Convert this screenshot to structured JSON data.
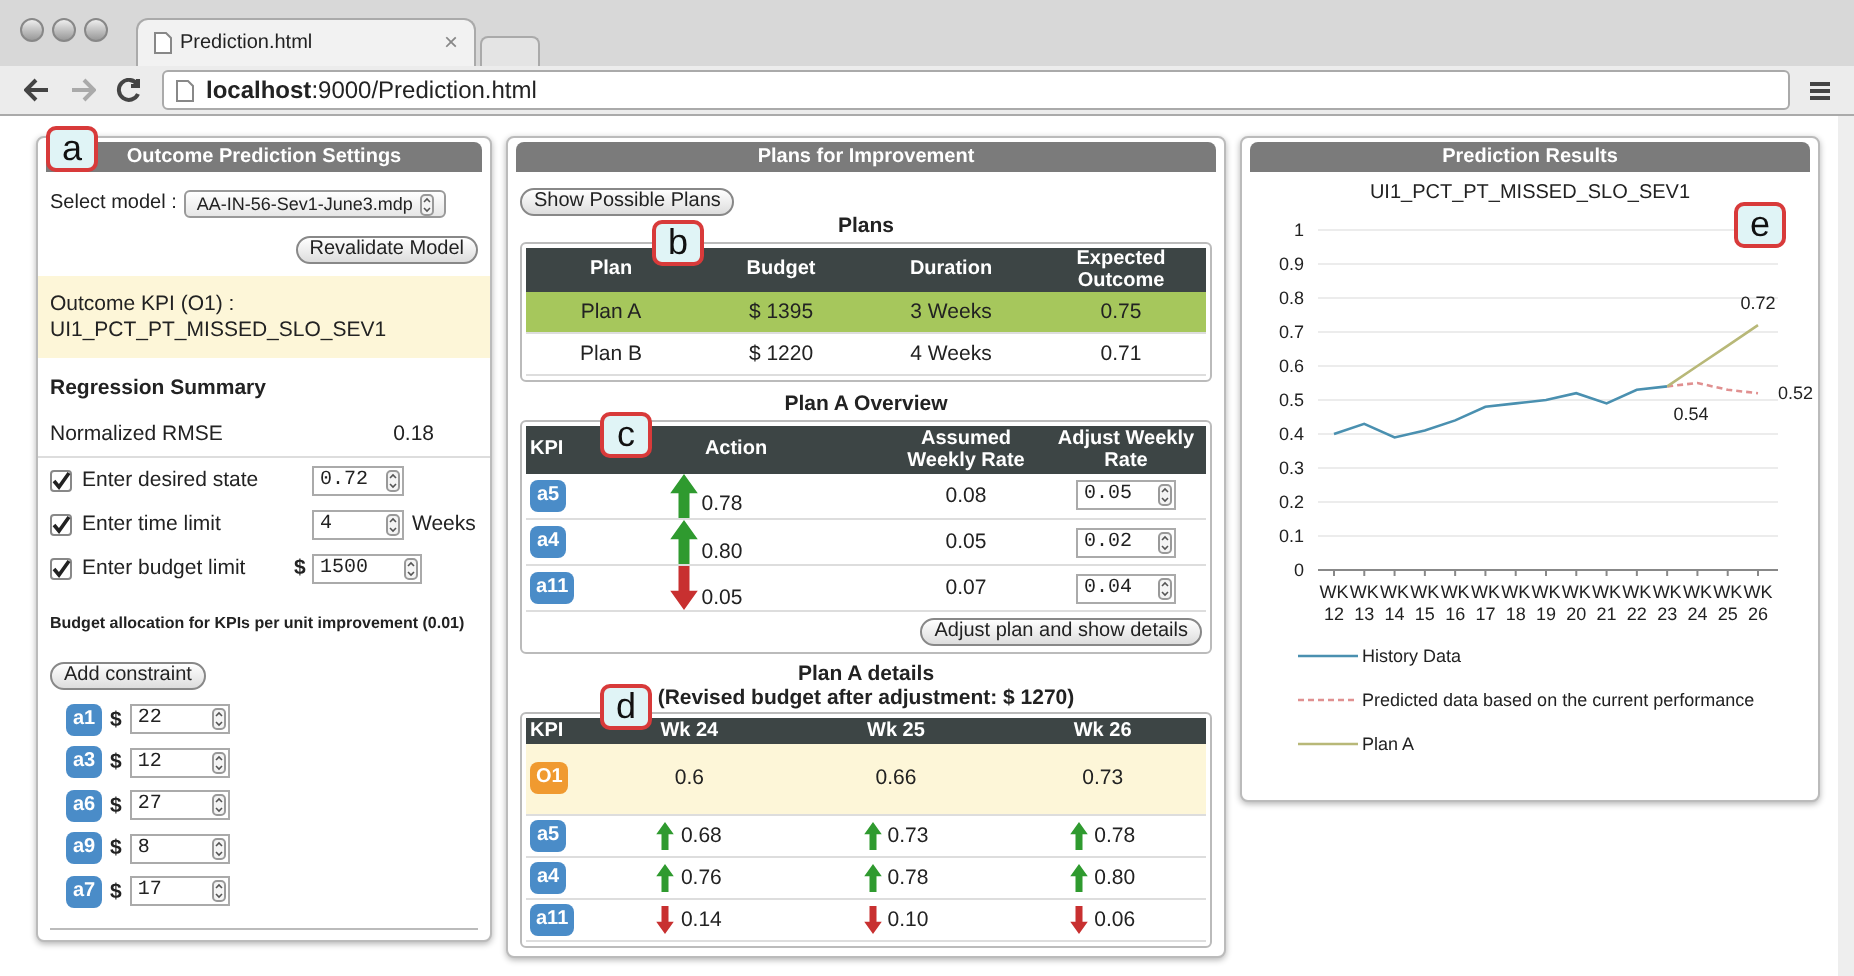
{
  "browser": {
    "tab_title": "Prediction.html",
    "tab_close": "×",
    "url": "**localhost**:9000/Prediction.html"
  },
  "settings": {
    "annotation": "a",
    "title": "Outcome Prediction Settings",
    "model_label": "Select model :",
    "model_value": "AA-IN-56-Sev1-June3.mdp",
    "revalidate_button": "Revalidate Model",
    "outcome_label": "Outcome KPI (O1) :",
    "outcome_value": "UI1_PCT_PT_MISSED_SLO_SEV1",
    "regression_title": "Regression Summary",
    "rmse_label": "Normalized RMSE",
    "rmse_value": "0.18",
    "constraints": [
      {
        "label": "Enter desired state",
        "checked": true,
        "value": "0.72"
      },
      {
        "label": "Enter time limit",
        "checked": true,
        "value": "4",
        "unit": "Weeks"
      },
      {
        "label": "Enter budget limit",
        "checked": true,
        "prefix": "$",
        "value": "1500"
      }
    ],
    "budget_title": "Budget allocation for KPIs per unit improvement (0.01)",
    "add_constraint_button": "Add constraint",
    "allocations": [
      {
        "kpi": "a1",
        "currency": "$",
        "value": "22"
      },
      {
        "kpi": "a3",
        "currency": "$",
        "value": "12"
      },
      {
        "kpi": "a6",
        "currency": "$",
        "value": "27"
      },
      {
        "kpi": "a9",
        "currency": "$",
        "value": "8"
      },
      {
        "kpi": "a7",
        "currency": "$",
        "value": "17"
      }
    ]
  },
  "plans": {
    "title": "Plans for Improvement",
    "show_button": "Show Possible Plans",
    "table_title": "Plans",
    "annotation": "b",
    "columns": [
      "Plan",
      "Budget",
      "Duration",
      "Expected Outcome"
    ],
    "rows": [
      {
        "cells": [
          "Plan A",
          "$ 1395",
          "3 Weeks",
          "0.75"
        ],
        "selected": true
      },
      {
        "cells": [
          "Plan B",
          "$ 1220",
          "4 Weeks",
          "0.71"
        ],
        "selected": false
      }
    ]
  },
  "overview": {
    "title": "Plan A Overview",
    "annotation": "c",
    "columns": [
      "KPI",
      "Action",
      "Assumed Weekly Rate",
      "Adjust Weekly Rate"
    ],
    "rows": [
      {
        "kpi": "a5",
        "kind": "up",
        "action": "0.78",
        "assumed": "0.08",
        "adjust": "0.05"
      },
      {
        "kpi": "a4",
        "kind": "up",
        "action": "0.80",
        "assumed": "0.05",
        "adjust": "0.02"
      },
      {
        "kpi": "a11",
        "kind": "down",
        "action": "0.05",
        "assumed": "0.07",
        "adjust": "0.04"
      }
    ],
    "adjust_button": "Adjust plan and show details"
  },
  "details": {
    "title": "Plan A details",
    "subtitle": "(Revised budget after adjustment: $ 1270)",
    "annotation": "d",
    "kpi_column": "KPI",
    "columns": [
      "Wk 24",
      "Wk 25",
      "Wk 26"
    ],
    "rows": [
      {
        "kpi": "O1",
        "kind": "outcome",
        "cells": [
          {
            "kind": "plain",
            "value": "0.6"
          },
          {
            "kind": "plain",
            "value": "0.66"
          },
          {
            "kind": "plain",
            "value": "0.73"
          }
        ]
      },
      {
        "kpi": "a5",
        "kind": "action",
        "cells": [
          {
            "kind": "up",
            "value": "0.68"
          },
          {
            "kind": "up",
            "value": "0.73"
          },
          {
            "kind": "up",
            "value": "0.78"
          }
        ]
      },
      {
        "kpi": "a4",
        "kind": "action",
        "cells": [
          {
            "kind": "up",
            "value": "0.76"
          },
          {
            "kind": "up",
            "value": "0.78"
          },
          {
            "kind": "up",
            "value": "0.80"
          }
        ]
      },
      {
        "kpi": "a11",
        "kind": "action",
        "cells": [
          {
            "kind": "down",
            "value": "0.14"
          },
          {
            "kind": "down",
            "value": "0.10"
          },
          {
            "kind": "down",
            "value": "0.06"
          }
        ]
      }
    ]
  },
  "results": {
    "title": "Prediction Results",
    "annotation": "e",
    "chart_data": {
      "type": "line",
      "title": "UI1_PCT_PT_MISSED_SLO_SEV1",
      "grid": true,
      "categories": [
        "WK 12",
        "WK 13",
        "WK 14",
        "WK 15",
        "WK 16",
        "WK 17",
        "WK 18",
        "WK 19",
        "WK 20",
        "WK 21",
        "WK 22",
        "WK 23",
        "WK 24",
        "WK 25",
        "WK 26"
      ],
      "series": [
        {
          "name": "History Data",
          "color": "#4a90b0",
          "line_style": "solid",
          "values": [
            0.4,
            0.43,
            0.39,
            0.41,
            0.44,
            0.48,
            0.49,
            0.5,
            0.52,
            0.49,
            0.53,
            0.54,
            null,
            null,
            null
          ]
        },
        {
          "name": "Predicted data based on the current performance",
          "color": "#e09090",
          "line_style": "dashed",
          "values": [
            null,
            null,
            null,
            null,
            null,
            null,
            null,
            null,
            null,
            null,
            null,
            0.54,
            0.55,
            0.53,
            0.52
          ]
        },
        {
          "name": "Plan A",
          "color": "#b8b878",
          "line_style": "solid",
          "values": [
            null,
            null,
            null,
            null,
            null,
            null,
            null,
            null,
            null,
            null,
            null,
            0.54,
            0.6,
            0.66,
            0.72
          ]
        }
      ],
      "ylim": [
        0,
        1
      ],
      "yticks": [
        {
          "value": 0,
          "label": "0"
        },
        {
          "value": 0.1,
          "label": "0.1"
        },
        {
          "value": 0.2,
          "label": "0.2"
        },
        {
          "value": 0.3,
          "label": "0.3"
        },
        {
          "value": 0.4,
          "label": "0.4"
        },
        {
          "value": 0.5,
          "label": "0.5"
        },
        {
          "value": 0.6,
          "label": "0.6"
        },
        {
          "value": 0.7,
          "label": "0.7"
        },
        {
          "value": 0.8,
          "label": "0.8"
        },
        {
          "value": 0.9,
          "label": "0.9"
        },
        {
          "value": 1,
          "label": "1"
        }
      ],
      "annotations": [
        {
          "x": "WK 23",
          "y": 0.54,
          "text": "0.54"
        },
        {
          "x": "WK 26",
          "y": 0.72,
          "text": "0.72"
        },
        {
          "x": "WK 26",
          "y": 0.52,
          "text": "0.52"
        }
      ]
    }
  }
}
